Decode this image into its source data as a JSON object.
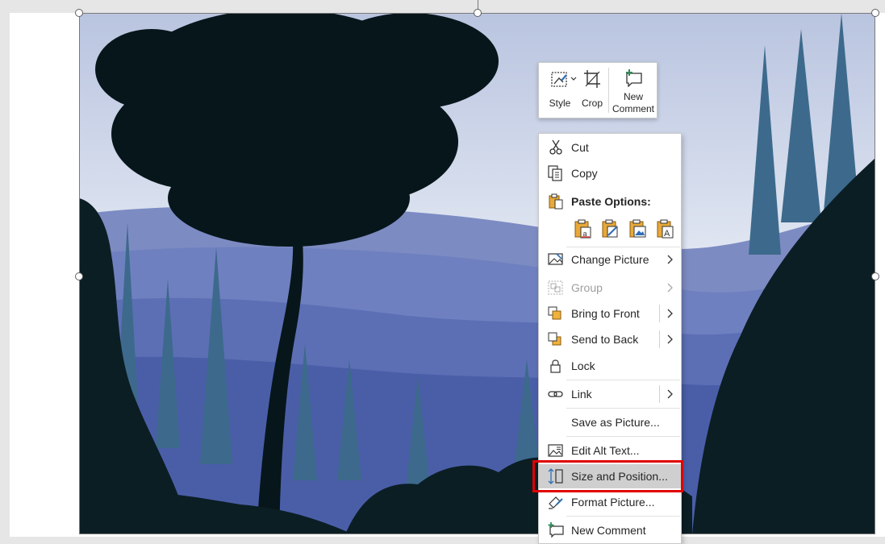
{
  "mini_toolbar": {
    "style_label": "Style",
    "crop_label": "Crop",
    "new_comment_line1": "New",
    "new_comment_line2": "Comment"
  },
  "context_menu": {
    "cut": "Cut",
    "copy": "Copy",
    "paste_options": "Paste Options:",
    "paste_icons": [
      "paste-use-destination-theme-icon",
      "paste-keep-source-formatting-icon",
      "paste-picture-icon",
      "paste-keep-text-only-icon"
    ],
    "change_picture": "Change Picture",
    "group": "Group",
    "bring_to_front": "Bring to Front",
    "send_to_back": "Send to Back",
    "lock": "Lock",
    "link": "Link",
    "save_as_picture": "Save as Picture...",
    "edit_alt_text": "Edit Alt Text...",
    "size_and_position": "Size and Position...",
    "format_picture": "Format Picture...",
    "new_comment": "New Comment"
  },
  "colors": {
    "highlight_border": "#e00000",
    "hovered_item_bg": "#cfcfcf",
    "disabled_text": "#9e9e9e"
  },
  "highlighted_item": "size_and_position"
}
